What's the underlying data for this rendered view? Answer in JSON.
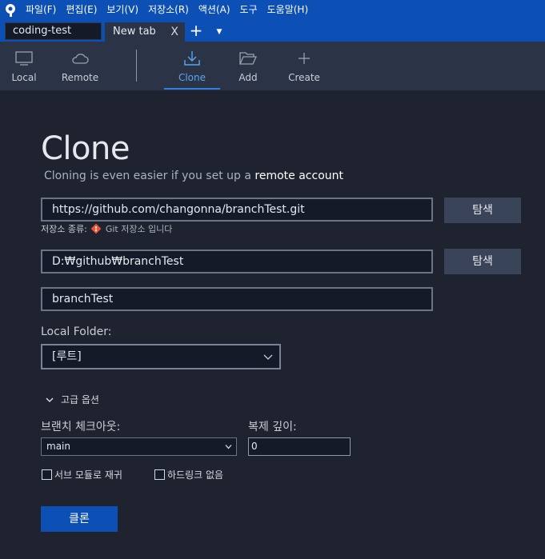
{
  "menu": [
    "파일(F)",
    "편집(E)",
    "보기(V)",
    "저장소(R)",
    "액션(A)",
    "도구",
    "도움말(H)"
  ],
  "tabs": {
    "repo_tab": "coding-test",
    "new_tab": "New tab",
    "close_glyph": "X",
    "add_glyph": "+",
    "dropdown_glyph": "▼"
  },
  "toolbar": {
    "local": "Local",
    "remote": "Remote",
    "clone": "Clone",
    "add": "Add",
    "create": "Create"
  },
  "page": {
    "title": "Clone",
    "subtitle_prefix": "Cloning is even easier if you set up a ",
    "subtitle_link": "remote account",
    "source_url": "https://github.com/changonna/branchTest.git",
    "browse_label": "탐색",
    "repo_type_label": "저장소 종류:",
    "repo_type_value": "Git 저장소 입니다",
    "dest_path": "D:₩github₩branchTest",
    "name": "branchTest",
    "local_folder_label": "Local Folder:",
    "local_folder_value": "[루트]",
    "advanced_label": "고급 옵션",
    "branch_label": "브랜치 체크아웃:",
    "branch_value": "main",
    "depth_label": "복제 깊이:",
    "depth_value": "0",
    "recurse_label": "서브 모듈로 재귀",
    "no_hardlinks_label": "하드링크 없음",
    "clone_button": "클론"
  },
  "colors": {
    "menubar": "#0c4fb5",
    "toolbar": "#2b3346",
    "background": "#1f2330",
    "accent": "#2f7fe0",
    "git_icon": "#f05033"
  }
}
